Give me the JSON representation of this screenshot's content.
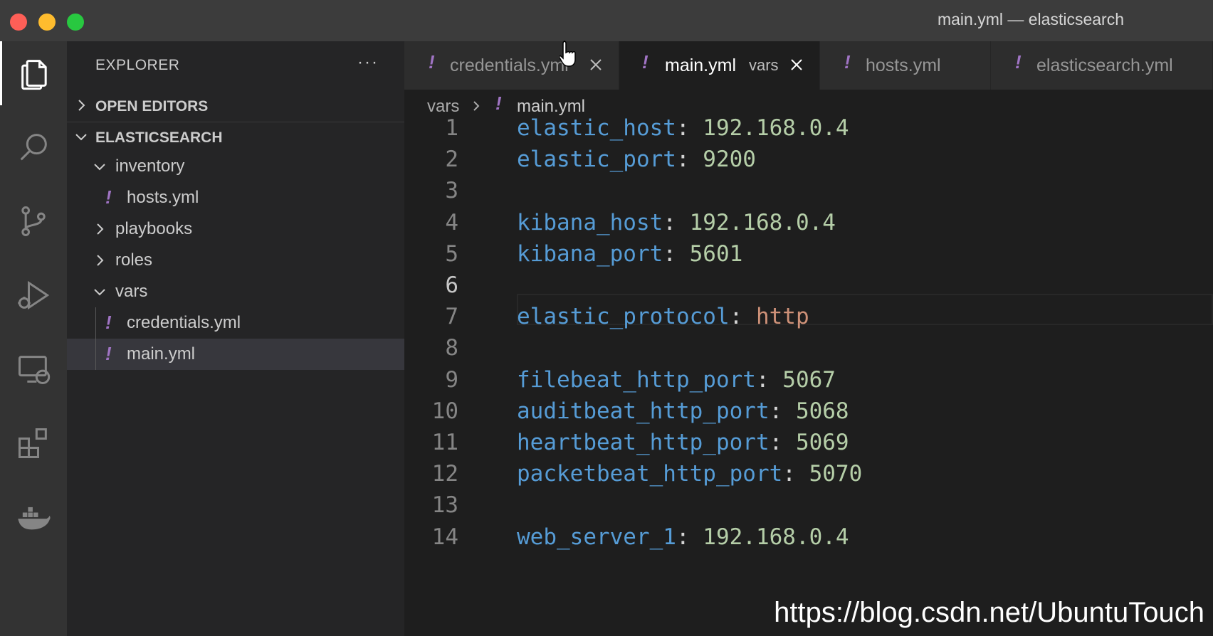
{
  "window": {
    "title": "main.yml — elasticsearch"
  },
  "activity_bar": {
    "items": [
      "files-icon",
      "search-icon",
      "source-control-icon",
      "run-debug-icon",
      "remote-explorer-icon",
      "extensions-icon",
      "docker-icon"
    ]
  },
  "sidebar": {
    "header": "EXPLORER",
    "more": "···",
    "sections": {
      "open_editors": "OPEN EDITORS",
      "workspace": "ELASTICSEARCH"
    },
    "tree": [
      {
        "label": "inventory",
        "type": "folder",
        "expanded": true
      },
      {
        "label": "hosts.yml",
        "type": "file",
        "icon": "!"
      },
      {
        "label": "playbooks",
        "type": "folder",
        "expanded": false
      },
      {
        "label": "roles",
        "type": "folder",
        "expanded": false
      },
      {
        "label": "vars",
        "type": "folder",
        "expanded": true
      },
      {
        "label": "credentials.yml",
        "type": "file",
        "icon": "!"
      },
      {
        "label": "main.yml",
        "type": "file",
        "icon": "!",
        "selected": true
      }
    ]
  },
  "tabs": [
    {
      "label": "credentials.yml",
      "icon": "!",
      "active": false
    },
    {
      "label": "main.yml",
      "description": "vars",
      "icon": "!",
      "active": true
    },
    {
      "label": "hosts.yml",
      "icon": "!",
      "active": false
    },
    {
      "label": "elasticsearch.yml",
      "icon": "!",
      "active": false
    }
  ],
  "breadcrumb": {
    "folder": "vars",
    "icon": "!",
    "file": "main.yml"
  },
  "editor": {
    "current_line": 6,
    "lines": [
      {
        "num": "1",
        "key": "elastic_host",
        "value": "192.168.0.4",
        "vtype": "n"
      },
      {
        "num": "2",
        "key": "elastic_port",
        "value": "9200",
        "vtype": "n"
      },
      {
        "num": "3",
        "key": "",
        "value": "",
        "vtype": ""
      },
      {
        "num": "4",
        "key": "kibana_host",
        "value": "192.168.0.4",
        "vtype": "n"
      },
      {
        "num": "5",
        "key": "kibana_port",
        "value": "5601",
        "vtype": "n"
      },
      {
        "num": "6",
        "key": "",
        "value": "",
        "vtype": ""
      },
      {
        "num": "7",
        "key": "elastic_protocol",
        "value": "http",
        "vtype": "s"
      },
      {
        "num": "8",
        "key": "",
        "value": "",
        "vtype": ""
      },
      {
        "num": "9",
        "key": "filebeat_http_port",
        "value": "5067",
        "vtype": "n"
      },
      {
        "num": "10",
        "key": "auditbeat_http_port",
        "value": "5068",
        "vtype": "n"
      },
      {
        "num": "11",
        "key": "heartbeat_http_port",
        "value": "5069",
        "vtype": "n"
      },
      {
        "num": "12",
        "key": "packetbeat_http_port",
        "value": "5070",
        "vtype": "n"
      },
      {
        "num": "13",
        "key": "",
        "value": "",
        "vtype": ""
      },
      {
        "num": "14",
        "key": "web_server_1",
        "value": "192.168.0.4",
        "vtype": "n"
      }
    ]
  },
  "overlay": {
    "url": "https://blog.csdn.net/UbuntuTouch"
  },
  "colors": {
    "key": "#569cd6",
    "number": "#b5cea8",
    "string": "#ce9178",
    "yaml_icon": "#a074c4"
  }
}
